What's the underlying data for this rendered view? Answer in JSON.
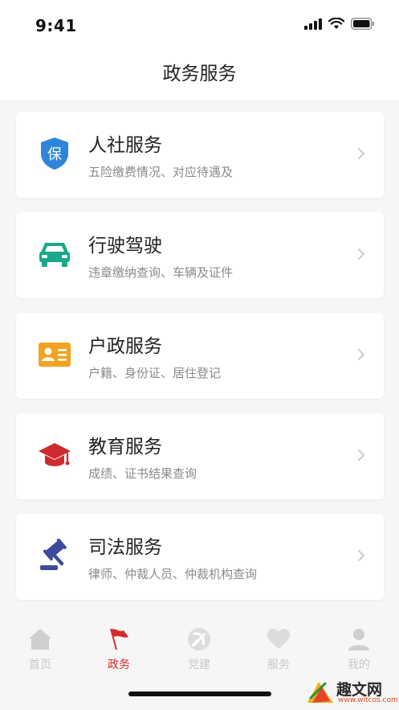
{
  "status_bar": {
    "time": "9:41"
  },
  "nav": {
    "title": "政务服务"
  },
  "services": [
    {
      "title": "人社服务",
      "subtitle": "五险缴费情况、对应待遇及",
      "icon": "shield-icon",
      "icon_text": "保",
      "color": "#2f86d9"
    },
    {
      "title": "行驶驾驶",
      "subtitle": "违章缴纳查询、车辆及证件",
      "icon": "car-icon",
      "color": "#1aa889"
    },
    {
      "title": "户政服务",
      "subtitle": "户籍、身份证、居住登记",
      "icon": "id-card-icon",
      "color": "#f1a321"
    },
    {
      "title": "教育服务",
      "subtitle": "成绩、证书结果查询",
      "icon": "graduation-cap-icon",
      "color": "#cf2a2e"
    },
    {
      "title": "司法服务",
      "subtitle": "律师、仲裁人员、仲裁机构查询",
      "icon": "gavel-icon",
      "color": "#3d4a9e"
    }
  ],
  "tabbar": {
    "items": [
      {
        "label": "首页",
        "icon": "home-icon",
        "active": false
      },
      {
        "label": "政务",
        "icon": "flag-icon",
        "active": true
      },
      {
        "label": "党建",
        "icon": "party-emblem-icon",
        "active": false
      },
      {
        "label": "服务",
        "icon": "heart-icon",
        "active": false
      },
      {
        "label": "我的",
        "icon": "user-icon",
        "active": false
      }
    ],
    "active_color": "#d52a2a",
    "inactive_color": "#c8c8c8"
  },
  "watermark": {
    "text": "趣文网",
    "url": "www.witcos.com"
  }
}
